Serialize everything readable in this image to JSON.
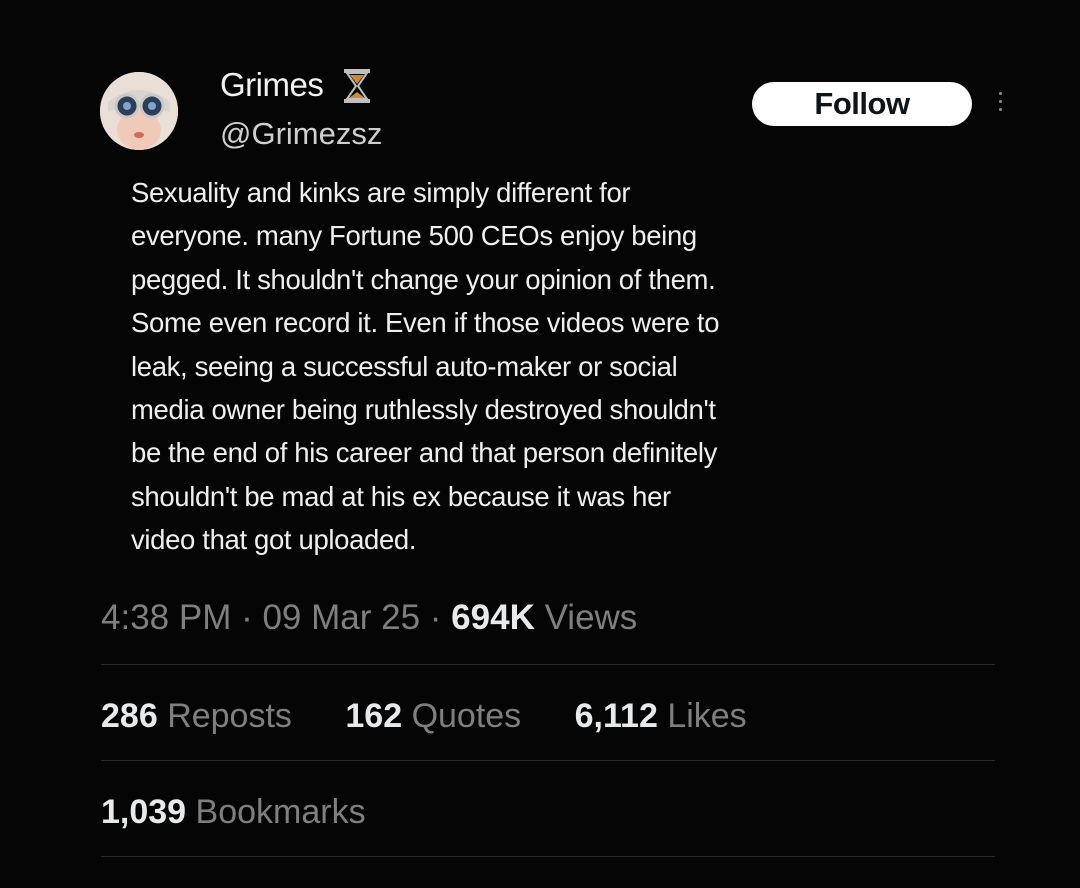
{
  "user": {
    "display_name": "Grimes",
    "handle": "@Grimezsz",
    "badge_icon": "hourglass-icon"
  },
  "follow_label": "Follow",
  "more_icon": "more-vertical-icon",
  "tweet_text": "Sexuality and kinks are simply different for\neveryone. many Fortune 500 CEOs enjoy being\npegged. It shouldn't change your opinion of them.\nSome even record it. Even if those videos were to\nleak, seeing a successful auto-maker or social\nmedia owner being ruthlessly destroyed shouldn't\nbe the end of his career and that person definitely\nshouldn't be mad at his ex because it was her\nvideo that got uploaded.",
  "meta": {
    "time": "4:38 PM",
    "separator": " · ",
    "date": "09 Mar 25",
    "views_count": "694K",
    "views_label": "Views"
  },
  "stats": [
    {
      "count": "286",
      "label": "Reposts"
    },
    {
      "count": "162",
      "label": "Quotes"
    },
    {
      "count": "6,112",
      "label": "Likes"
    }
  ],
  "bookmarks": {
    "count": "1,039",
    "label": "Bookmarks"
  },
  "colors": {
    "background": "#050505",
    "text": "#e7e9ea",
    "muted": "#7f7f7f",
    "button_bg": "#ffffff",
    "divider": "#2a2a2a"
  }
}
